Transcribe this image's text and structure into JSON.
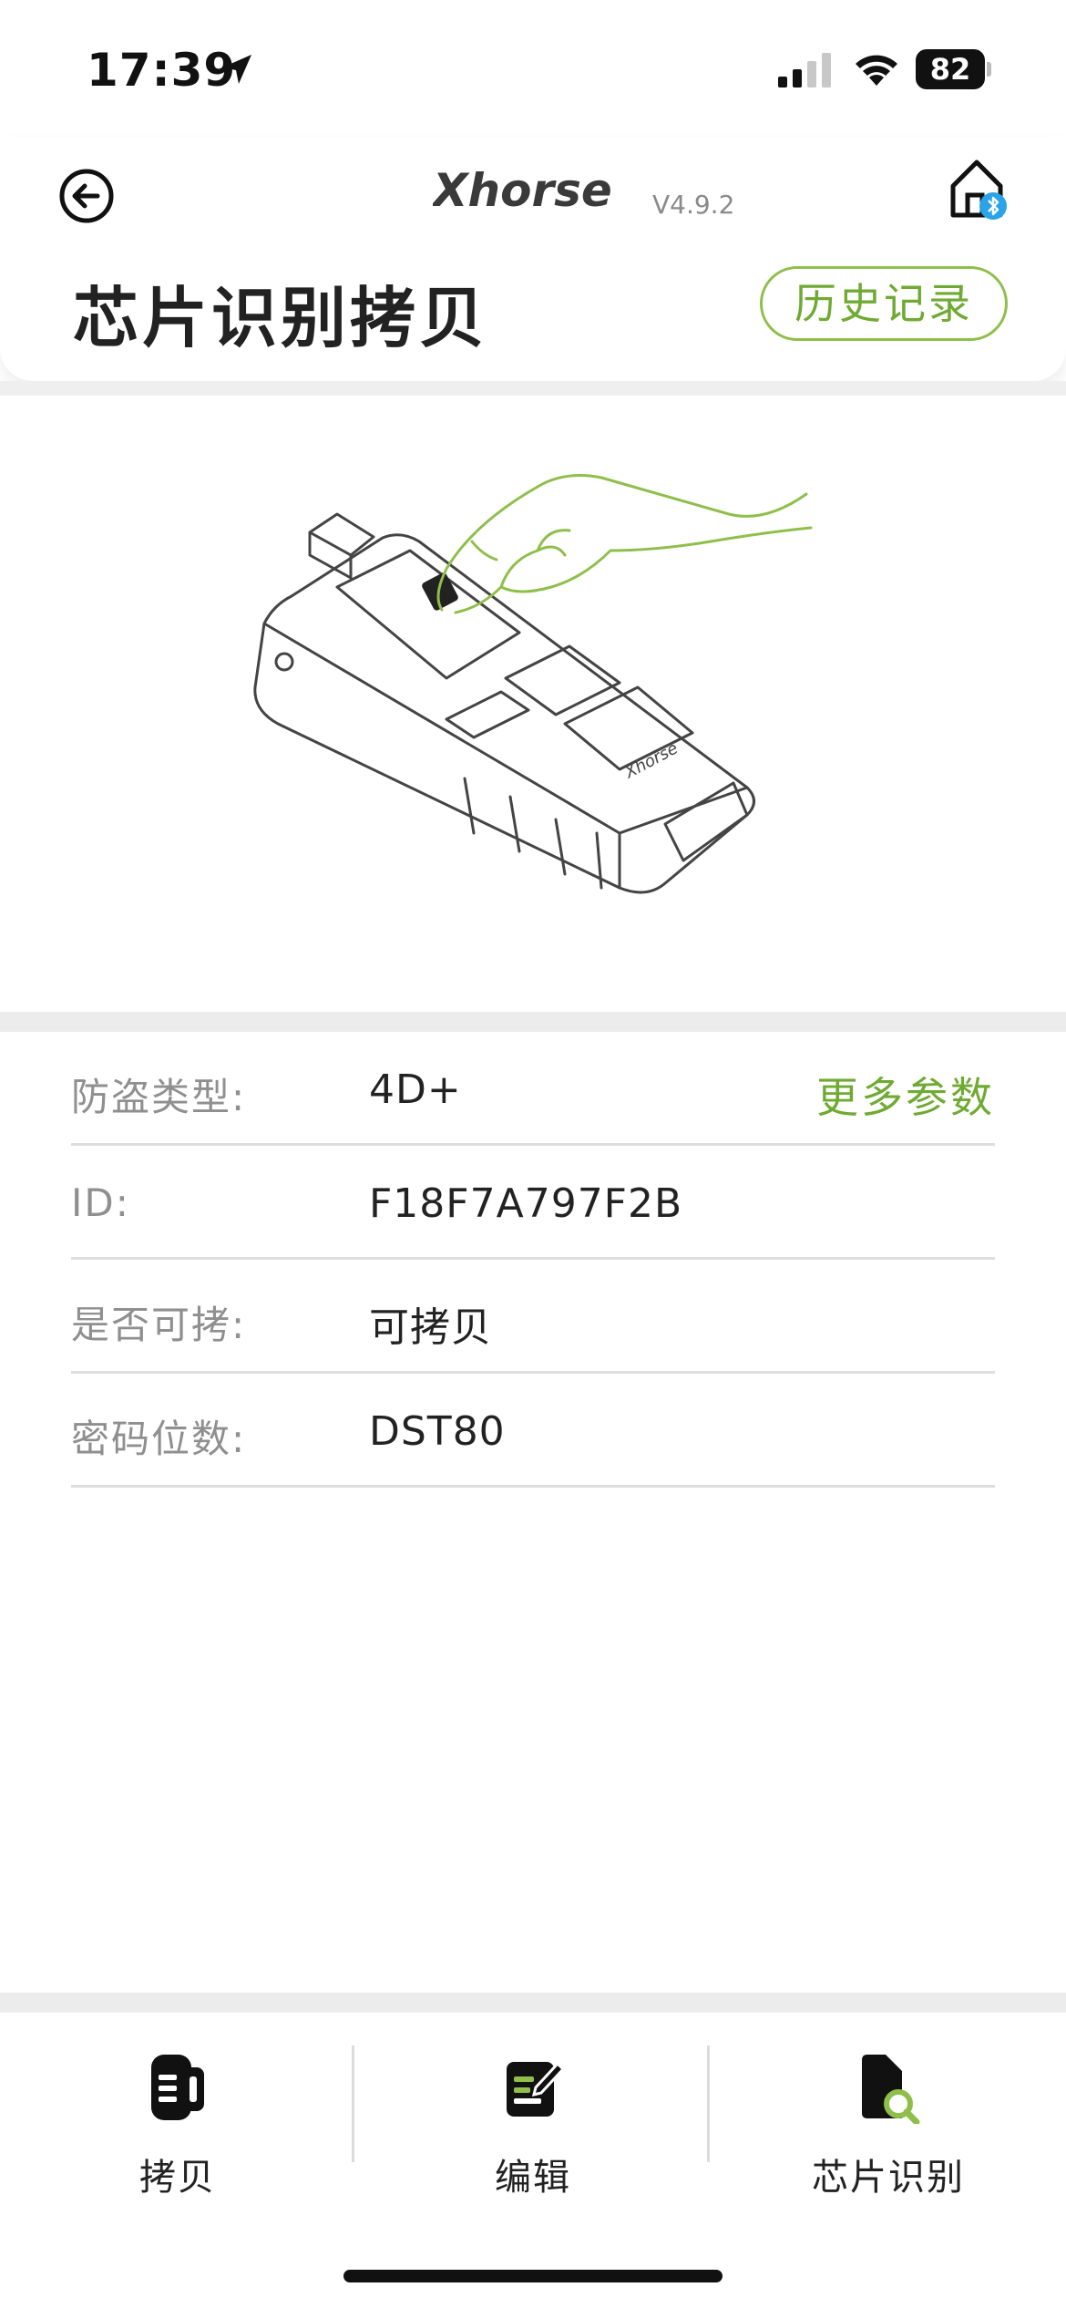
{
  "status_bar": {
    "time": "17:39",
    "battery": "82"
  },
  "header": {
    "brand": "Xhorse",
    "version": "V4.9.2",
    "title": "芯片识别拷贝",
    "history_label": "历史记录"
  },
  "info": {
    "more_label": "更多参数",
    "rows": [
      {
        "label": "防盗类型:",
        "value": "4D+"
      },
      {
        "label": "ID:",
        "value": "F18F7A797F2B"
      },
      {
        "label": "是否可拷:",
        "value": "可拷贝"
      },
      {
        "label": "密码位数:",
        "value": "DST80"
      }
    ]
  },
  "tabs": [
    {
      "label": "拷贝",
      "icon": "car-key-icon"
    },
    {
      "label": "编辑",
      "icon": "edit-icon"
    },
    {
      "label": "芯片识别",
      "icon": "chip-search-icon"
    }
  ],
  "colors": {
    "accent": "#6faa32",
    "accent_border": "#8fbf4a"
  }
}
